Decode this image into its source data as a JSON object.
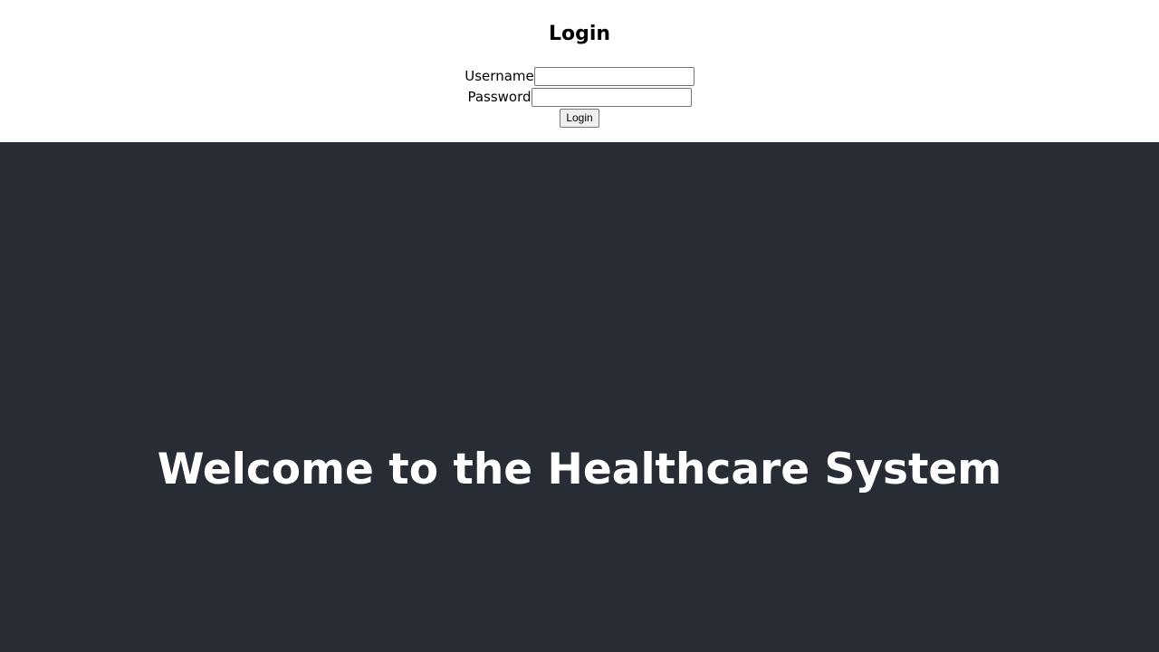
{
  "login": {
    "title": "Login",
    "username_label": "Username",
    "username_value": "",
    "password_label": "Password",
    "password_value": "",
    "submit_label": "Login"
  },
  "hero": {
    "title": "Welcome to the Healthcare System"
  },
  "colors": {
    "hero_background": "#282c34",
    "hero_text": "#ffffff",
    "page_background": "#ffffff"
  }
}
